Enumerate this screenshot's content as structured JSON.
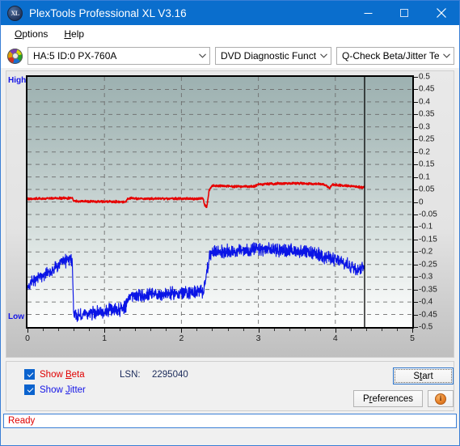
{
  "window": {
    "title": "PlexTools Professional XL V3.16",
    "app_icon": "xl-logo-icon",
    "minimize": "minimize-icon",
    "maximize": "maximize-icon",
    "close": "close-icon"
  },
  "menu": {
    "items": [
      {
        "label": "Options",
        "accesskey": "O"
      },
      {
        "label": "Help",
        "accesskey": "H"
      }
    ]
  },
  "toolbar": {
    "drive_icon": "disc-icon",
    "drive_combo": {
      "value": "HA:5 ID:0  PX-760A"
    },
    "function_combo": {
      "value": "DVD Diagnostic Functions"
    },
    "test_combo": {
      "value": "Q-Check Beta/Jitter Test"
    }
  },
  "chart_labels": {
    "high": "High",
    "low": "Low"
  },
  "controls": {
    "show_beta": {
      "label_pre": "Show ",
      "label_key": "B",
      "label_post": "eta",
      "checked": true
    },
    "show_jitter": {
      "label_pre": "Show ",
      "label_key": "J",
      "label_post": "itter",
      "checked": true
    },
    "lsn_label": "LSN:",
    "lsn_value": "2295040",
    "start_pre": "S",
    "start_key": "t",
    "start_post": "art",
    "preferences_pre": "P",
    "preferences_key": "r",
    "preferences_post": "eferences",
    "info_glyph": "i",
    "info_icon": "info-icon"
  },
  "status": {
    "text": "Ready"
  },
  "chart_data": {
    "type": "line",
    "title": "Q-Check Beta/Jitter Test",
    "xlabel": "",
    "ylabel": "",
    "xlim": [
      0,
      5
    ],
    "ylim": [
      -0.5,
      0.5
    ],
    "grid": true,
    "legend_position": "bottom-left",
    "x_ticks": [
      0,
      1,
      2,
      3,
      4,
      5
    ],
    "y_ticks": [
      0.5,
      0.45,
      0.4,
      0.35,
      0.3,
      0.25,
      0.2,
      0.15,
      0.1,
      0.05,
      0,
      -0.05,
      -0.1,
      -0.15,
      -0.2,
      -0.25,
      -0.3,
      -0.35,
      -0.4,
      -0.45,
      -0.5
    ],
    "y_axis_top_label": "High",
    "y_axis_bottom_label": "Low",
    "data_end_marker_x": 4.38,
    "colors": {
      "beta": "#e60000",
      "jitter": "#0a14e6",
      "plot_bg_top": "#9db1b1",
      "plot_bg_bottom": "#fdfefe"
    },
    "series": [
      {
        "name": "Beta",
        "color": "#e60000",
        "x": [
          0.0,
          0.1,
          0.2,
          0.3,
          0.4,
          0.5,
          0.58,
          0.6,
          0.62,
          0.7,
          0.8,
          0.9,
          1.0,
          1.1,
          1.2,
          1.28,
          1.3,
          1.32,
          1.4,
          1.5,
          1.6,
          1.7,
          1.8,
          1.9,
          2.0,
          2.1,
          2.2,
          2.26,
          2.28,
          2.3,
          2.33,
          2.36,
          2.4,
          2.5,
          2.6,
          2.7,
          2.8,
          2.9,
          2.95,
          3.0,
          3.1,
          3.2,
          3.3,
          3.4,
          3.5,
          3.6,
          3.7,
          3.8,
          3.85,
          3.9,
          3.93,
          3.96,
          4.0,
          4.1,
          4.2,
          4.3,
          4.36,
          4.38
        ],
        "y": [
          0.012,
          0.013,
          0.013,
          0.014,
          0.015,
          0.015,
          0.015,
          0.005,
          0.003,
          0.003,
          0.002,
          0.002,
          0.002,
          0.001,
          0.001,
          0.001,
          0.013,
          0.014,
          0.014,
          0.013,
          0.013,
          0.013,
          0.013,
          0.013,
          0.013,
          0.013,
          0.013,
          0.013,
          0.013,
          -0.01,
          -0.022,
          0.045,
          0.065,
          0.064,
          0.063,
          0.062,
          0.062,
          0.062,
          0.062,
          0.07,
          0.072,
          0.073,
          0.074,
          0.075,
          0.075,
          0.074,
          0.073,
          0.072,
          0.071,
          0.06,
          0.055,
          0.07,
          0.068,
          0.066,
          0.064,
          0.06,
          0.056,
          0.065
        ]
      },
      {
        "name": "Jitter",
        "color": "#0a14e6",
        "x": [
          0.0,
          0.05,
          0.1,
          0.15,
          0.2,
          0.25,
          0.3,
          0.35,
          0.4,
          0.45,
          0.5,
          0.55,
          0.58,
          0.6,
          0.62,
          0.65,
          0.7,
          0.8,
          0.9,
          1.0,
          1.1,
          1.2,
          1.25,
          1.28,
          1.3,
          1.35,
          1.4,
          1.5,
          1.6,
          1.7,
          1.8,
          1.9,
          2.0,
          2.1,
          2.2,
          2.28,
          2.32,
          2.36,
          2.4,
          2.45,
          2.5,
          2.6,
          2.7,
          2.8,
          2.9,
          3.0,
          3.1,
          3.2,
          3.3,
          3.4,
          3.5,
          3.6,
          3.7,
          3.8,
          3.9,
          4.0,
          4.1,
          4.15,
          4.2,
          4.25,
          4.3,
          4.35,
          4.38
        ],
        "y": [
          -0.33,
          -0.32,
          -0.31,
          -0.3,
          -0.295,
          -0.288,
          -0.28,
          -0.268,
          -0.255,
          -0.245,
          -0.235,
          -0.23,
          -0.228,
          -0.445,
          -0.452,
          -0.455,
          -0.452,
          -0.445,
          -0.442,
          -0.438,
          -0.432,
          -0.428,
          -0.425,
          -0.423,
          -0.38,
          -0.378,
          -0.376,
          -0.374,
          -0.372,
          -0.37,
          -0.368,
          -0.366,
          -0.364,
          -0.362,
          -0.36,
          -0.358,
          -0.3,
          -0.225,
          -0.2,
          -0.198,
          -0.2,
          -0.198,
          -0.196,
          -0.194,
          -0.192,
          -0.19,
          -0.192,
          -0.19,
          -0.192,
          -0.194,
          -0.196,
          -0.2,
          -0.205,
          -0.212,
          -0.222,
          -0.232,
          -0.245,
          -0.252,
          -0.258,
          -0.262,
          -0.265,
          -0.262,
          -0.245
        ]
      }
    ]
  }
}
